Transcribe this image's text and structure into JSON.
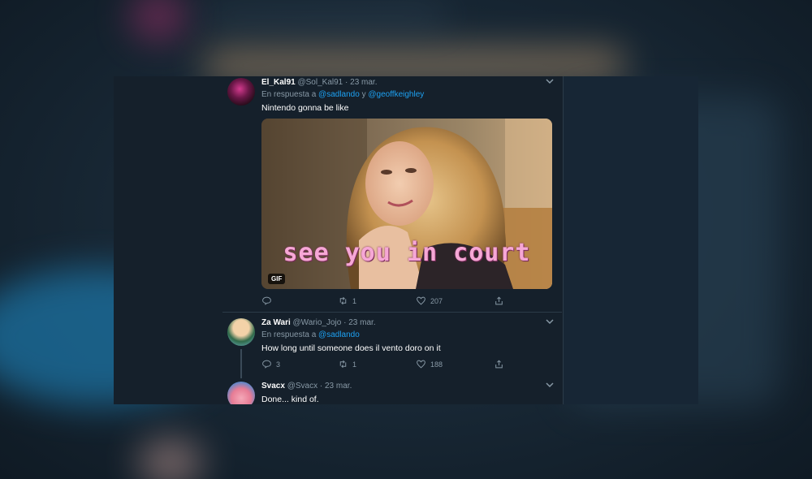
{
  "tweets": [
    {
      "name": "El_Kal91",
      "handle": "@Sol_Kal91",
      "separator": "·",
      "date": "23 mar.",
      "reply_prefix": "En respuesta a",
      "mention1": "@sadlando",
      "reply_and": "y",
      "mention2": "@geoffkeighley",
      "text": "Nintendo gonna be like",
      "media": {
        "caption": "see you in court",
        "badge": "GIF"
      },
      "actions": {
        "reply_count": "",
        "retweet_count": "1",
        "like_count": "207"
      }
    },
    {
      "name": "Za Wari",
      "handle": "@Wario_Jojo",
      "separator": "·",
      "date": "23 mar.",
      "reply_prefix": "En respuesta a",
      "mention1": "@sadlando",
      "text": "How long until someone does il vento doro  on it",
      "actions": {
        "reply_count": "3",
        "retweet_count": "1",
        "like_count": "188"
      }
    },
    {
      "name": "Svacx",
      "handle": "@Svacx",
      "separator": "·",
      "date": "23 mar.",
      "text": "Done... kind of."
    }
  ],
  "colors": {
    "background": "#15202b",
    "accent": "#1da1f2",
    "muted": "#8899a6",
    "text": "#ffffff"
  },
  "icons": [
    "chevron-down-icon",
    "reply-icon",
    "retweet-icon",
    "like-icon",
    "share-icon"
  ]
}
